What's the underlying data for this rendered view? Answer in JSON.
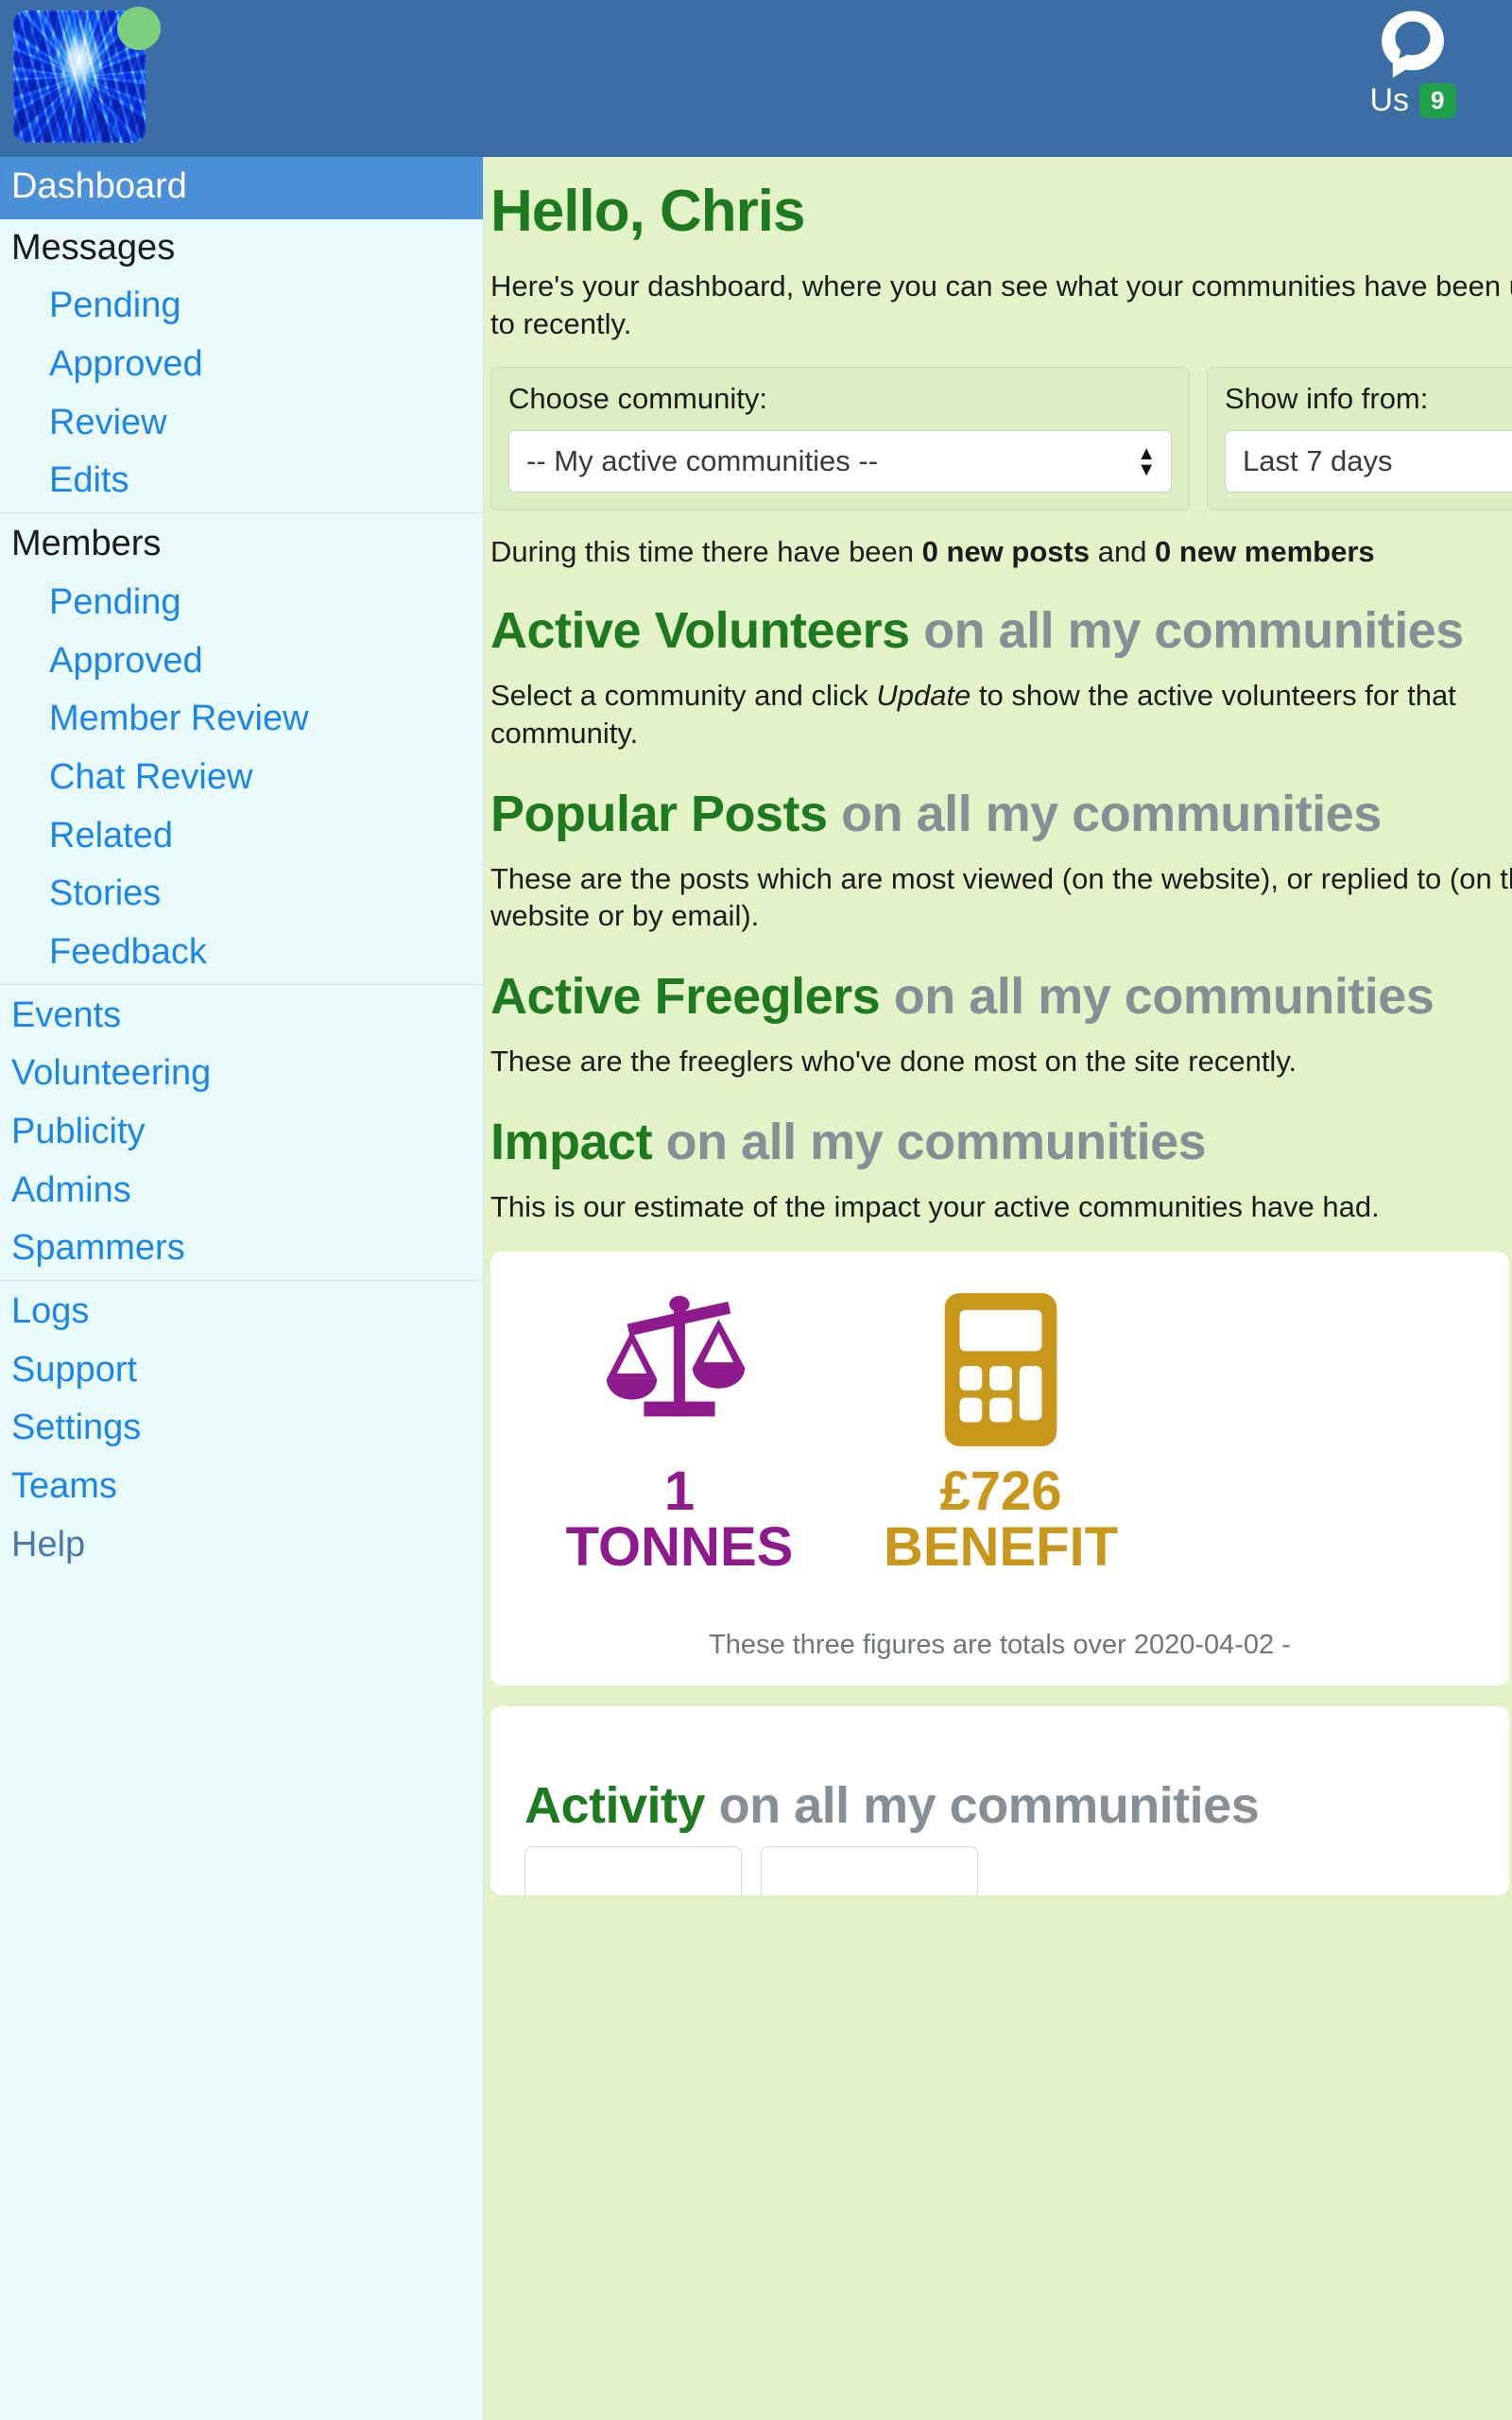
{
  "topbar": {
    "avatar_name": "user-avatar",
    "online_status": "online",
    "chat_icon": "chat-bubble-icon",
    "us_label": "Us",
    "us_badge_count": "9"
  },
  "sidebar": {
    "active_item": "Dashboard",
    "groups": [
      {
        "head": "Messages",
        "items": [
          "Pending",
          "Approved",
          "Review",
          "Edits"
        ]
      },
      {
        "head": "Members",
        "items": [
          "Pending",
          "Approved",
          "Member Review",
          "Chat Review",
          "Related",
          "Stories",
          "Feedback"
        ]
      }
    ],
    "top_items": [
      "Events",
      "Volunteering",
      "Publicity",
      "Admins",
      "Spammers"
    ],
    "bottom_items": [
      "Logs",
      "Support",
      "Settings",
      "Teams"
    ],
    "muted_item": "Help"
  },
  "main": {
    "greeting": "Hello, Chris",
    "lead": "Here's your dashboard, where you can see what your communities have been up to recently.",
    "selectors": [
      {
        "label": "Choose community:",
        "value": "-- My active communities --"
      },
      {
        "label": "Show info from:",
        "value": "Last 7 days"
      }
    ],
    "during_prefix": "During this time there have been ",
    "during_posts": "0 new posts",
    "during_mid": " and ",
    "during_members": "0 new members",
    "sections": [
      {
        "title_green": "Active Volunteers",
        "title_grey": "on all my communities",
        "desc": "Select a community and click Update to show the active volunteers for that community.",
        "desc_italic": "Update"
      },
      {
        "title_green": "Popular Posts",
        "title_grey": "on all my communities",
        "desc": "These are the posts which are most viewed (on the website), or replied to (on the website or by email)."
      },
      {
        "title_green": "Active Freeglers",
        "title_grey": "on all my communities",
        "desc": "These are the freeglers who've done most on the site recently."
      },
      {
        "title_green": "Impact",
        "title_grey": "on all my communities",
        "desc": "This is our estimate of the impact your active communities have had."
      }
    ],
    "impact": {
      "items": [
        {
          "icon": "balance-scales-icon",
          "value": "1",
          "label": "TONNES",
          "color": "#8e1a8e"
        },
        {
          "icon": "calculator-icon",
          "value": "£726",
          "label": "BENEFIT",
          "color": "#c9971a"
        }
      ],
      "footer": "These three figures are totals over 2020-04-02 -"
    },
    "activity": {
      "title_green": "Activity",
      "title_grey": "on all my communities"
    }
  }
}
